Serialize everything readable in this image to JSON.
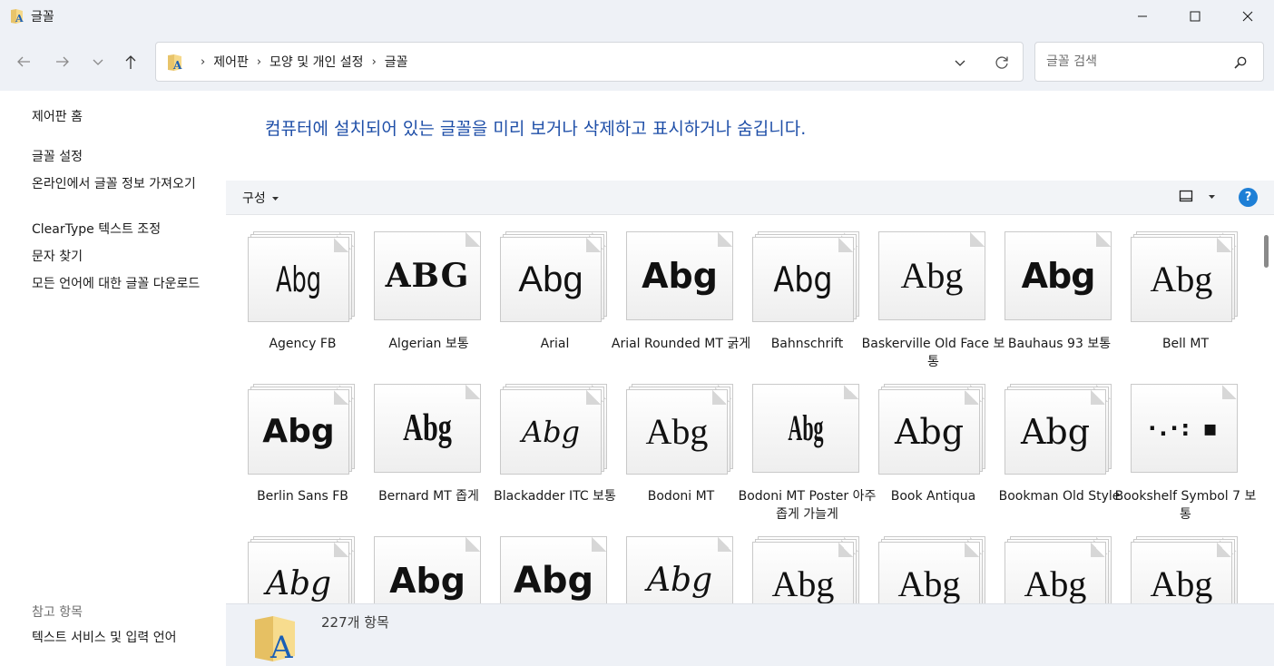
{
  "window": {
    "title": "글꼴"
  },
  "nav": {
    "back_icon": "back-arrow-icon",
    "forward_icon": "forward-arrow-icon",
    "recent_icon": "chevron-down-icon",
    "up_icon": "up-arrow-icon"
  },
  "address": {
    "crumbs": [
      "제어판",
      "모양 및 개인 설정",
      "글꼴"
    ]
  },
  "search": {
    "placeholder": "글꼴 검색"
  },
  "sidebar": {
    "links": [
      "제어판 홈",
      "글꼴 설정",
      "온라인에서 글꼴 정보 가져오기",
      "ClearType 텍스트 조정",
      "문자 찾기",
      "모든 언어에 대한 글꼴 다운로드"
    ],
    "see_also_heading": "참고 항목",
    "see_also": [
      "텍스트 서비스 및 입력 언어"
    ]
  },
  "main": {
    "headline": "컴퓨터에 설치되어 있는 글꼴을 미리 보거나 삭제하고 표시하거나 숨깁니다.",
    "organize_label": "구성",
    "help_label": "?"
  },
  "fonts": [
    {
      "name": "Agency FB",
      "sample": "Abg"
    },
    {
      "name": "Algerian 보통",
      "sample": "ABG"
    },
    {
      "name": "Arial",
      "sample": "Abg"
    },
    {
      "name": "Arial Rounded MT 굵게",
      "sample": "Abg"
    },
    {
      "name": "Bahnschrift",
      "sample": "Abg"
    },
    {
      "name": "Baskerville Old Face 보통",
      "sample": "Abg"
    },
    {
      "name": "Bauhaus 93 보통",
      "sample": "Abg"
    },
    {
      "name": "Bell MT",
      "sample": "Abg"
    },
    {
      "name": "Berlin Sans FB",
      "sample": "Abg"
    },
    {
      "name": "Bernard MT 좁게",
      "sample": "Abg"
    },
    {
      "name": "Blackadder ITC 보통",
      "sample": "Abg"
    },
    {
      "name": "Bodoni MT",
      "sample": "Abg"
    },
    {
      "name": "Bodoni MT Poster 아주 좁게 가늘게",
      "sample": "Abg"
    },
    {
      "name": "Book Antiqua",
      "sample": "Abg"
    },
    {
      "name": "Bookman Old Style",
      "sample": "Abg"
    },
    {
      "name": "Bookshelf Symbol 7 보통",
      "sample": "·.·: ▪"
    },
    {
      "name": "",
      "sample": "Abg"
    },
    {
      "name": "",
      "sample": "Abg"
    },
    {
      "name": "",
      "sample": "Abg"
    },
    {
      "name": "",
      "sample": "Abg"
    },
    {
      "name": "",
      "sample": "Abg"
    },
    {
      "name": "",
      "sample": "Abg"
    },
    {
      "name": "",
      "sample": "Abg"
    },
    {
      "name": "",
      "sample": "Abg"
    }
  ],
  "status": {
    "item_count": "227개 항목"
  }
}
